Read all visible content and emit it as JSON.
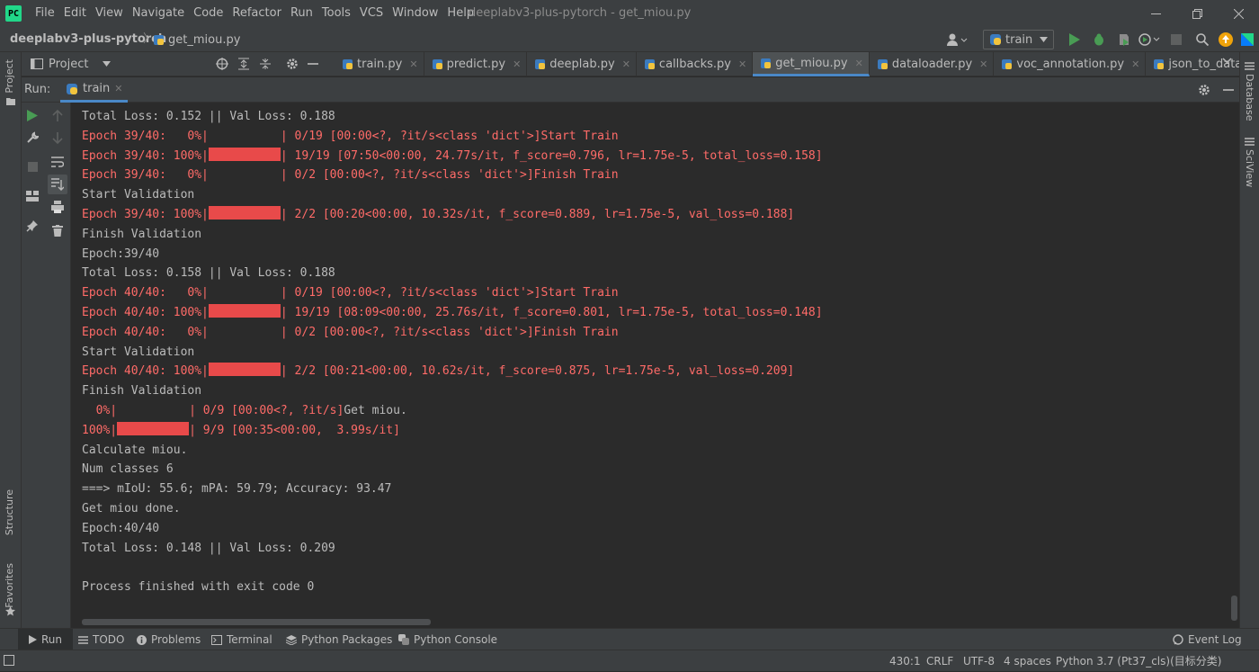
{
  "window": {
    "title": "deeplabv3-plus-pytorch - get_miou.py",
    "menu": [
      "File",
      "Edit",
      "View",
      "Navigate",
      "Code",
      "Refactor",
      "Run",
      "Tools",
      "VCS",
      "Window",
      "Help"
    ]
  },
  "navbar": {
    "project": "deeplabv3-plus-pytorch",
    "file": "get_miou.py",
    "run_config": "train"
  },
  "toolbar": {
    "project_label": "Project"
  },
  "tabs": [
    {
      "label": "train.py",
      "active": false
    },
    {
      "label": "predict.py",
      "active": false
    },
    {
      "label": "deeplab.py",
      "active": false
    },
    {
      "label": "callbacks.py",
      "active": false
    },
    {
      "label": "get_miou.py",
      "active": true
    },
    {
      "label": "dataloader.py",
      "active": false
    },
    {
      "label": "voc_annotation.py",
      "active": false
    },
    {
      "label": "json_to_dataset.py",
      "active": false
    }
  ],
  "left_strip": {
    "project": "Project",
    "structure": "Structure",
    "favorites": "Favorites"
  },
  "right_strip": {
    "database": "Database",
    "sciview": "SciView"
  },
  "run": {
    "label": "Run:",
    "tab": "train"
  },
  "console": {
    "lines": [
      {
        "type": "norm",
        "text": "Total Loss: 0.152 || Val Loss: 0.188"
      },
      {
        "type": "red",
        "pre": "Epoch 39/40:   0%|",
        "bar": "empty",
        "post": "| 0/19 [00:00<?, ?it/s<class 'dict'>]Start Train"
      },
      {
        "type": "red",
        "pre": "Epoch 39/40: 100%|",
        "bar": "full",
        "post": "| 19/19 [07:50<00:00, 24.77s/it, f_score=0.796, lr=1.75e-5, total_loss=0.158]"
      },
      {
        "type": "red",
        "pre": "Epoch 39/40:   0%|",
        "bar": "empty",
        "post": "| 0/2 [00:00<?, ?it/s<class 'dict'>]Finish Train"
      },
      {
        "type": "norm",
        "text": "Start Validation"
      },
      {
        "type": "red",
        "pre": "Epoch 39/40: 100%|",
        "bar": "full",
        "post": "| 2/2 [00:20<00:00, 10.32s/it, f_score=0.889, lr=1.75e-5, val_loss=0.188]"
      },
      {
        "type": "norm",
        "text": "Finish Validation"
      },
      {
        "type": "norm",
        "text": "Epoch:39/40"
      },
      {
        "type": "norm",
        "text": "Total Loss: 0.158 || Val Loss: 0.188"
      },
      {
        "type": "red",
        "pre": "Epoch 40/40:   0%|",
        "bar": "empty",
        "post": "| 0/19 [00:00<?, ?it/s<class 'dict'>]Start Train"
      },
      {
        "type": "red",
        "pre": "Epoch 40/40: 100%|",
        "bar": "full",
        "post": "| 19/19 [08:09<00:00, 25.76s/it, f_score=0.801, lr=1.75e-5, total_loss=0.148]"
      },
      {
        "type": "red",
        "pre": "Epoch 40/40:   0%|",
        "bar": "empty",
        "post": "| 0/2 [00:00<?, ?it/s<class 'dict'>]Finish Train"
      },
      {
        "type": "norm",
        "text": "Start Validation"
      },
      {
        "type": "red",
        "pre": "Epoch 40/40: 100%|",
        "bar": "full",
        "post": "| 2/2 [00:21<00:00, 10.62s/it, f_score=0.875, lr=1.75e-5, val_loss=0.209]"
      },
      {
        "type": "norm",
        "text": "Finish Validation"
      },
      {
        "type": "red",
        "pre": "  0%|",
        "bar": "empty",
        "post": "| 0/9 [00:00<?, ?it/s]",
        "tail": "Get miou."
      },
      {
        "type": "red",
        "pre": "100%|",
        "bar": "full",
        "post": "| 9/9 [00:35<00:00,  3.99s/it]"
      },
      {
        "type": "norm",
        "text": "Calculate miou."
      },
      {
        "type": "norm",
        "text": "Num classes 6"
      },
      {
        "type": "norm",
        "text": "===> mIoU: 55.6; mPA: 59.79; Accuracy: 93.47"
      },
      {
        "type": "norm",
        "text": "Get miou done."
      },
      {
        "type": "norm",
        "text": "Epoch:40/40"
      },
      {
        "type": "norm",
        "text": "Total Loss: 0.148 || Val Loss: 0.209"
      },
      {
        "type": "norm",
        "text": ""
      },
      {
        "type": "norm",
        "text": "Process finished with exit code 0"
      }
    ]
  },
  "bottom_tabs": {
    "run": "Run",
    "todo": "TODO",
    "problems": "Problems",
    "terminal": "Terminal",
    "packages": "Python Packages",
    "console": "Python Console",
    "event_log": "Event Log"
  },
  "status": {
    "position": "430:1",
    "line_sep": "CRLF",
    "encoding": "UTF-8",
    "indent": "4 spaces",
    "interpreter": "Python 3.7 (Pt37_cls)(目标分类)"
  },
  "colors": {
    "accent": "#4a88c7",
    "error_text": "#ff6b68",
    "progress": "#e84a4a",
    "run_green": "#499c54"
  }
}
